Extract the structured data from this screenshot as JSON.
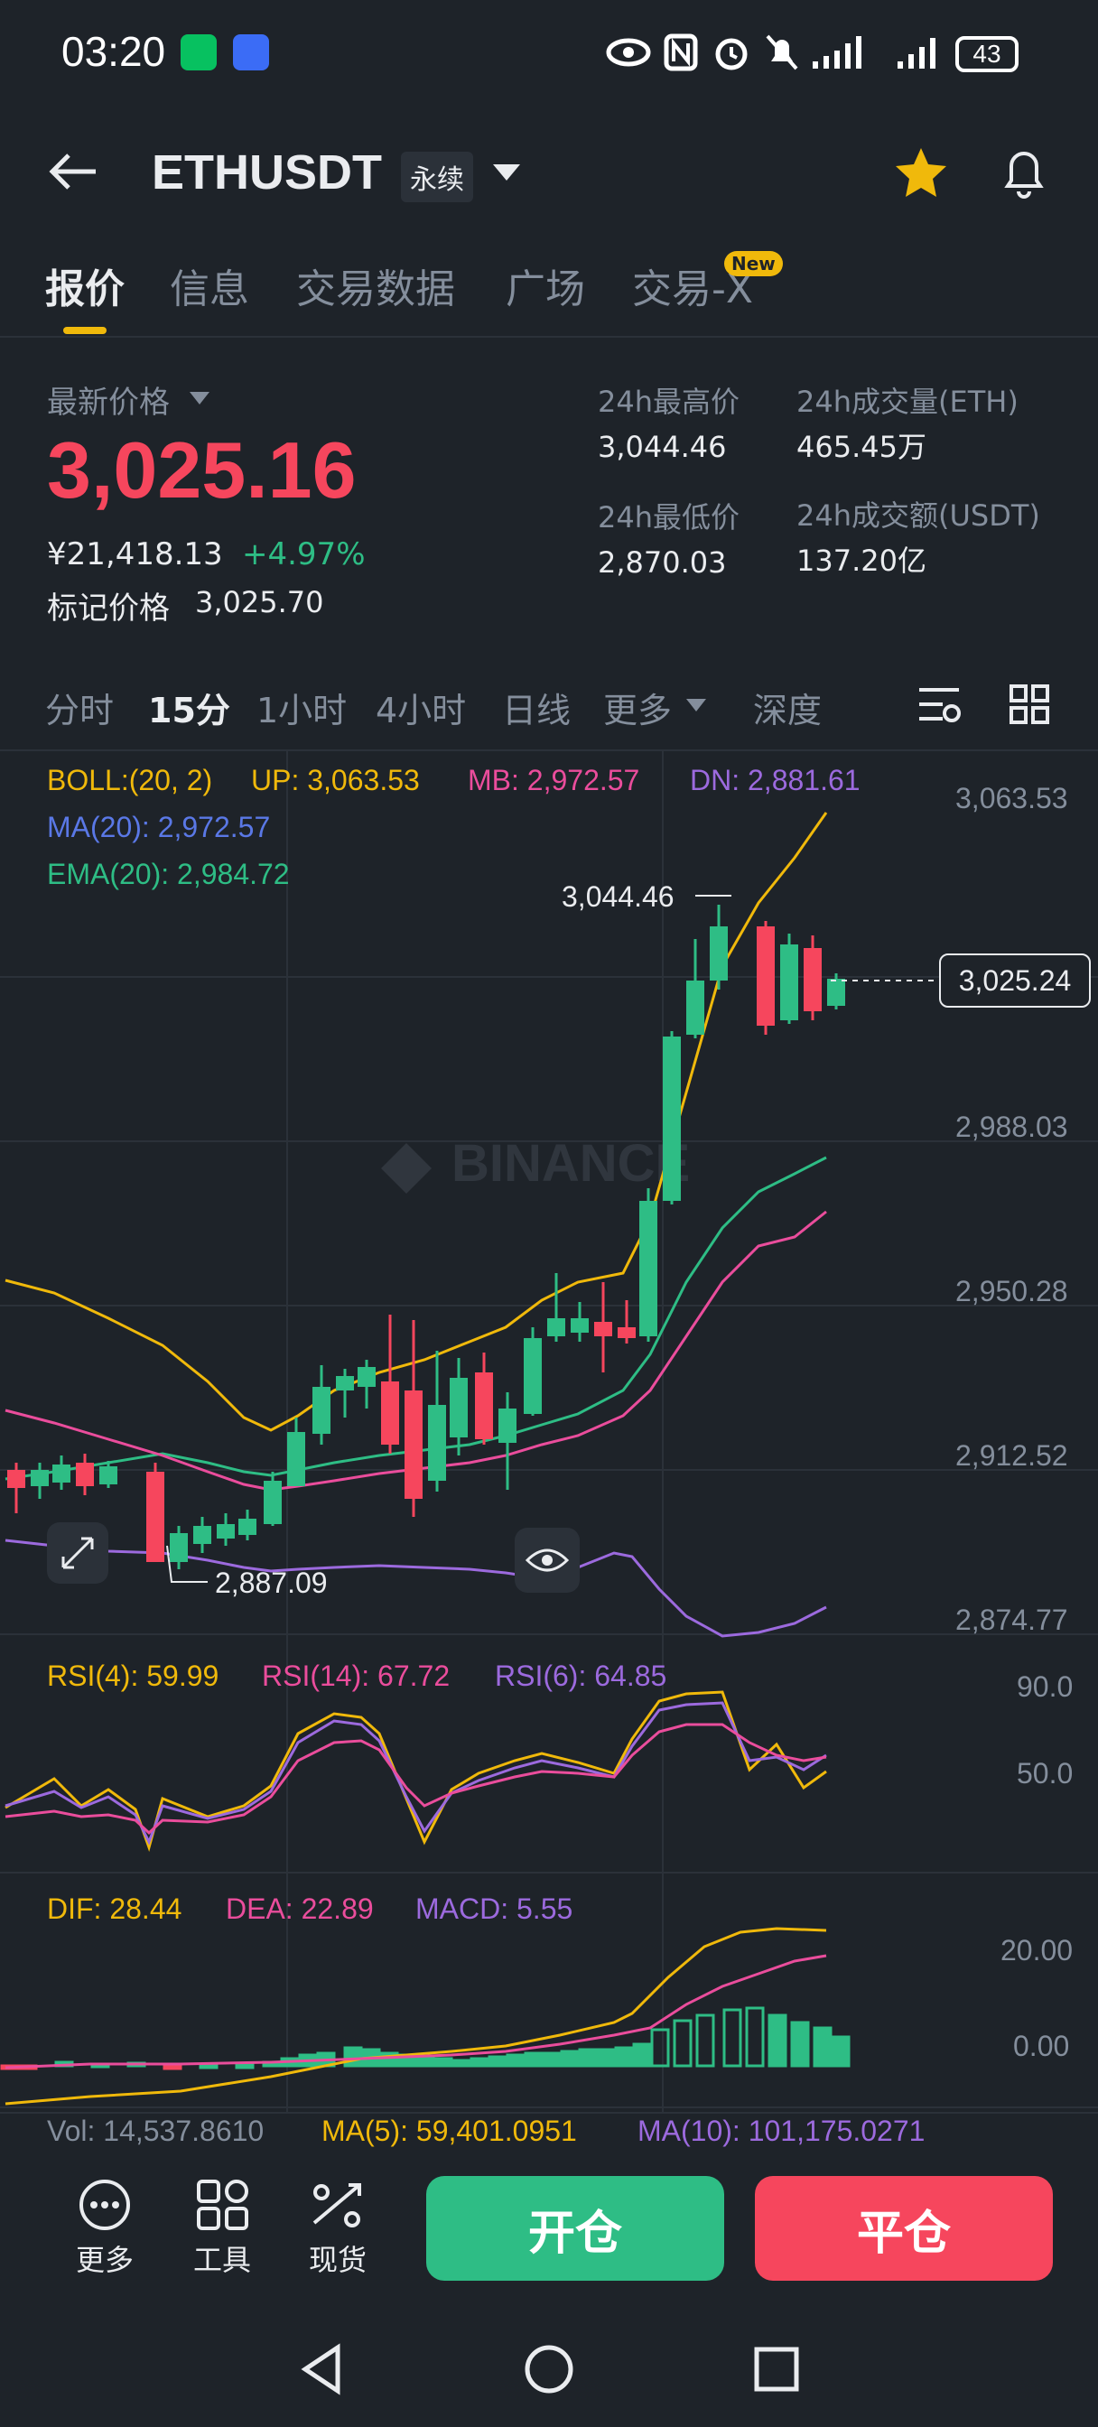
{
  "status_bar": {
    "time": "03:20",
    "battery": "43"
  },
  "header": {
    "symbol": "ETHUSDT",
    "contract_tag": "永续"
  },
  "tabs": [
    {
      "label": "报价"
    },
    {
      "label": "信息"
    },
    {
      "label": "交易数据"
    },
    {
      "label": "广场"
    },
    {
      "label": "交易-X"
    }
  ],
  "tab_badge": "New",
  "price": {
    "latest_label": "最新价格",
    "last": "3,025.16",
    "cny": "¥21,418.13",
    "change": "+4.97%",
    "mark_label": "标记价格",
    "mark": "3,025.70"
  },
  "stats": {
    "high_label": "24h最高价",
    "high": "3,044.46",
    "low_label": "24h最低价",
    "low": "2,870.03",
    "vol_label": "24h成交量(ETH)",
    "vol": "465.45万",
    "turnover_label": "24h成交额(USDT)",
    "turnover": "137.20亿"
  },
  "intervals": [
    "分时",
    "15分",
    "1小时",
    "4小时",
    "日线",
    "更多",
    "深度"
  ],
  "indicators": {
    "boll": "BOLL:(20, 2)",
    "up": "UP: 3,063.53",
    "mb": "MB: 2,972.57",
    "dn": "DN: 2,881.61",
    "ma": "MA(20): 2,972.57",
    "ema": "EMA(20): 2,984.72",
    "rsi4": "RSI(4): 59.99",
    "rsi14": "RSI(14): 67.72",
    "rsi6": "RSI(6): 64.85",
    "dif": "DIF: 28.44",
    "dea": "DEA: 22.89",
    "macd": "MACD: 5.55",
    "vol": "Vol: 14,537.8610",
    "vol_ma5": "MA(5): 59,401.0951",
    "vol_ma10": "MA(10): 101,175.0271"
  },
  "chart": {
    "price_axis": [
      "3,063.53",
      "2,988.03",
      "2,950.28",
      "2,912.52",
      "2,874.77"
    ],
    "current_price_tag": "3,025.24",
    "high_marker": "3,044.46",
    "low_marker": "2,887.09",
    "watermark": "BINANCE",
    "rsi_axis": [
      "90.0",
      "50.0"
    ],
    "macd_axis": [
      "20.00",
      "0.00"
    ]
  },
  "bottom": {
    "more": "更多",
    "tools": "工具",
    "spot": "现货",
    "open": "开仓",
    "close": "平仓"
  },
  "colors": {
    "up": "#2ebd85",
    "down": "#f6465d",
    "accent": "#f0b90b",
    "bg": "#1e2329"
  }
}
